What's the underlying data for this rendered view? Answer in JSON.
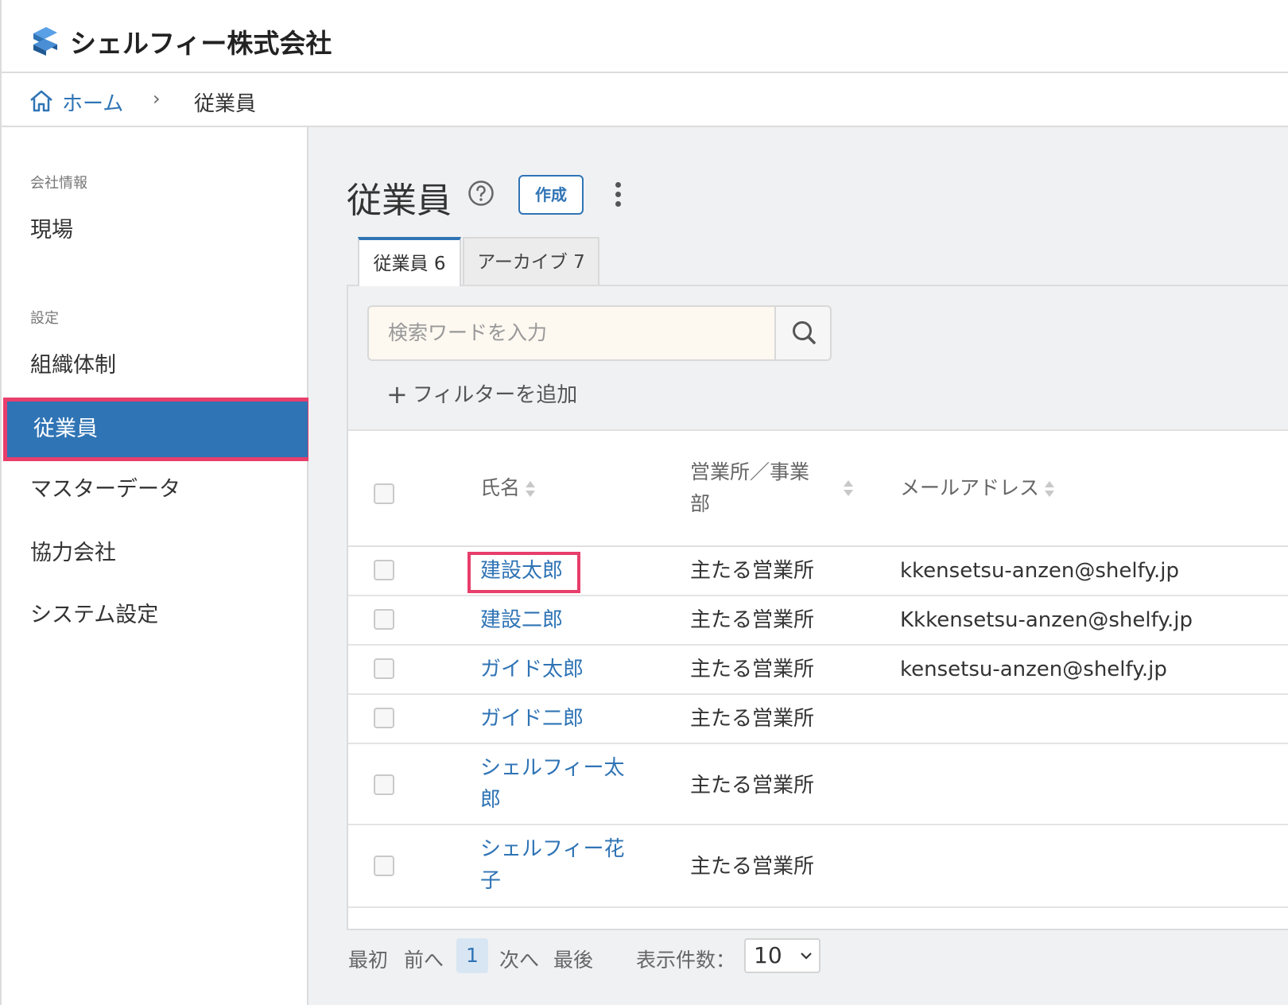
{
  "header": {
    "company": "シェルフィー株式会社"
  },
  "breadcrumb": {
    "home": "ホーム",
    "separator": "›",
    "current": "従業員"
  },
  "sidebar": {
    "section1": "会社情報",
    "items1": [
      "現場"
    ],
    "section2": "設定",
    "items2": [
      "組織体制",
      "従業員",
      "マスターデータ",
      "協力会社",
      "システム設定"
    ]
  },
  "page": {
    "title": "従業員",
    "create_label": "作成"
  },
  "tabs": [
    {
      "label": "従業員 6"
    },
    {
      "label": "アーカイブ 7"
    }
  ],
  "search": {
    "placeholder": "検索ワードを入力",
    "add_filter": "フィルターを追加"
  },
  "table": {
    "headers": {
      "name": "氏名",
      "office_line1": "営業所／事業",
      "office_line2": "部",
      "email": "メールアドレス"
    },
    "rows": [
      {
        "name": "建設太郎",
        "office": "主たる営業所",
        "email": "kkensetsu-anzen@shelfy.jp"
      },
      {
        "name": "建設二郎",
        "office": "主たる営業所",
        "email": "Kkkensetsu-anzen@shelfy.jp"
      },
      {
        "name": "ガイド太郎",
        "office": "主たる営業所",
        "email": "kensetsu-anzen@shelfy.jp"
      },
      {
        "name": "ガイド二郎",
        "office": "主たる営業所",
        "email": ""
      },
      {
        "name_line1": "シェルフィー太",
        "name_line2": "郎",
        "office": "主たる営業所",
        "email": ""
      },
      {
        "name_line1": "シェルフィー花",
        "name_line2": "子",
        "office": "主たる営業所",
        "email": ""
      }
    ]
  },
  "pager": {
    "first": "最初",
    "prev": "前へ",
    "current": "1",
    "next": "次へ",
    "last": "最後",
    "per_page_label": "表示件数：",
    "per_page": "10"
  },
  "colors": {
    "accent": "#2f74b5",
    "highlight": "#e83e6c"
  }
}
